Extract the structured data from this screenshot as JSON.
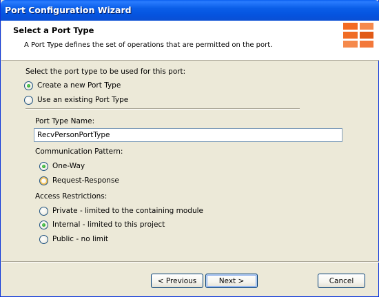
{
  "window": {
    "title": "Port Configuration Wizard"
  },
  "header": {
    "title": "Select a Port Type",
    "subtitle": "A Port Type defines the set of operations that are permitted on the port."
  },
  "port_type_choice": {
    "label": "Select the port type to be used for this port:",
    "options": [
      {
        "label": "Create a new Port Type",
        "selected": true
      },
      {
        "label": "Use an existing Port Type",
        "selected": false
      }
    ]
  },
  "port_type_name": {
    "label": "Port Type Name:",
    "value": "RecvPersonPortType"
  },
  "communication_pattern": {
    "label": "Communication Pattern:",
    "options": [
      {
        "label": "One-Way",
        "selected": true
      },
      {
        "label": "Request-Response",
        "selected": false
      }
    ]
  },
  "access_restrictions": {
    "label": "Access Restrictions:",
    "options": [
      {
        "label": "Private - limited to the containing module",
        "selected": false
      },
      {
        "label": "Internal - limited to this project",
        "selected": true
      },
      {
        "label": "Public - no limit",
        "selected": false
      }
    ]
  },
  "buttons": {
    "previous": "< Previous",
    "next": "Next >",
    "cancel": "Cancel"
  },
  "colors": {
    "titlebar": "#0a5ee8",
    "accent_orange": "#f36b23",
    "radio_check": "#21a121"
  }
}
